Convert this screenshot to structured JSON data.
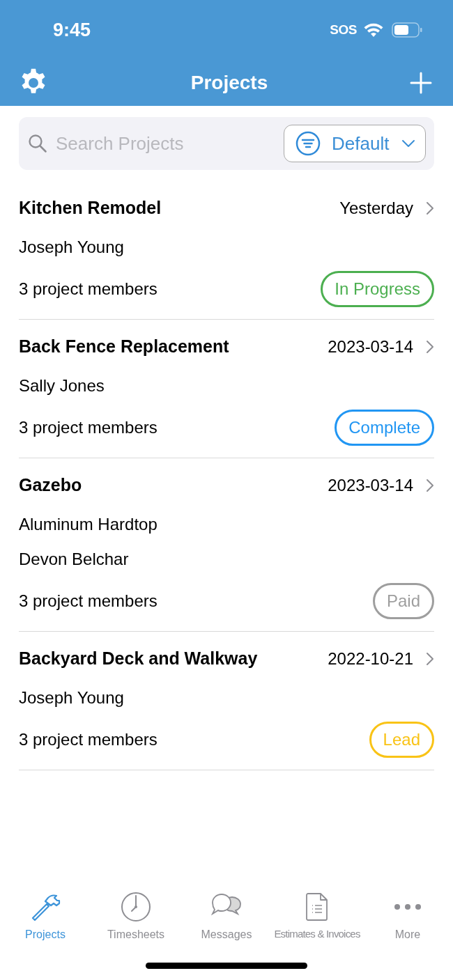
{
  "status_bar": {
    "time": "9:45",
    "carrier": "SOS"
  },
  "nav": {
    "title": "Projects"
  },
  "search": {
    "placeholder": "Search Projects",
    "sort": "Default"
  },
  "projects": [
    {
      "title": "Kitchen Remodel",
      "date": "Yesterday",
      "lines": [
        "Joseph Young"
      ],
      "members": "3 project members",
      "status": "In Progress",
      "color": "#4caf50"
    },
    {
      "title": "Back Fence Replacement",
      "date": "2023-03-14",
      "lines": [
        "Sally Jones"
      ],
      "members": "3 project members",
      "status": "Complete",
      "color": "#2196f3"
    },
    {
      "title": "Gazebo",
      "date": "2023-03-14",
      "lines": [
        "Aluminum Hardtop",
        "Devon Belchar"
      ],
      "members": "3 project members",
      "status": "Paid",
      "color": "#9e9e9e"
    },
    {
      "title": "Backyard Deck and Walkway",
      "date": "2022-10-21",
      "lines": [
        "Joseph Young"
      ],
      "members": "3 project members",
      "status": "Lead",
      "color": "#f9c316"
    }
  ],
  "tabs": [
    {
      "label": "Projects",
      "kind": "hammer",
      "selected": true
    },
    {
      "label": "Timesheets",
      "kind": "clock",
      "selected": false
    },
    {
      "label": "Messages",
      "kind": "chat",
      "selected": false
    },
    {
      "label": "Estimates & Invoices",
      "kind": "document",
      "selected": false
    },
    {
      "label": "More",
      "kind": "more",
      "selected": false
    }
  ]
}
